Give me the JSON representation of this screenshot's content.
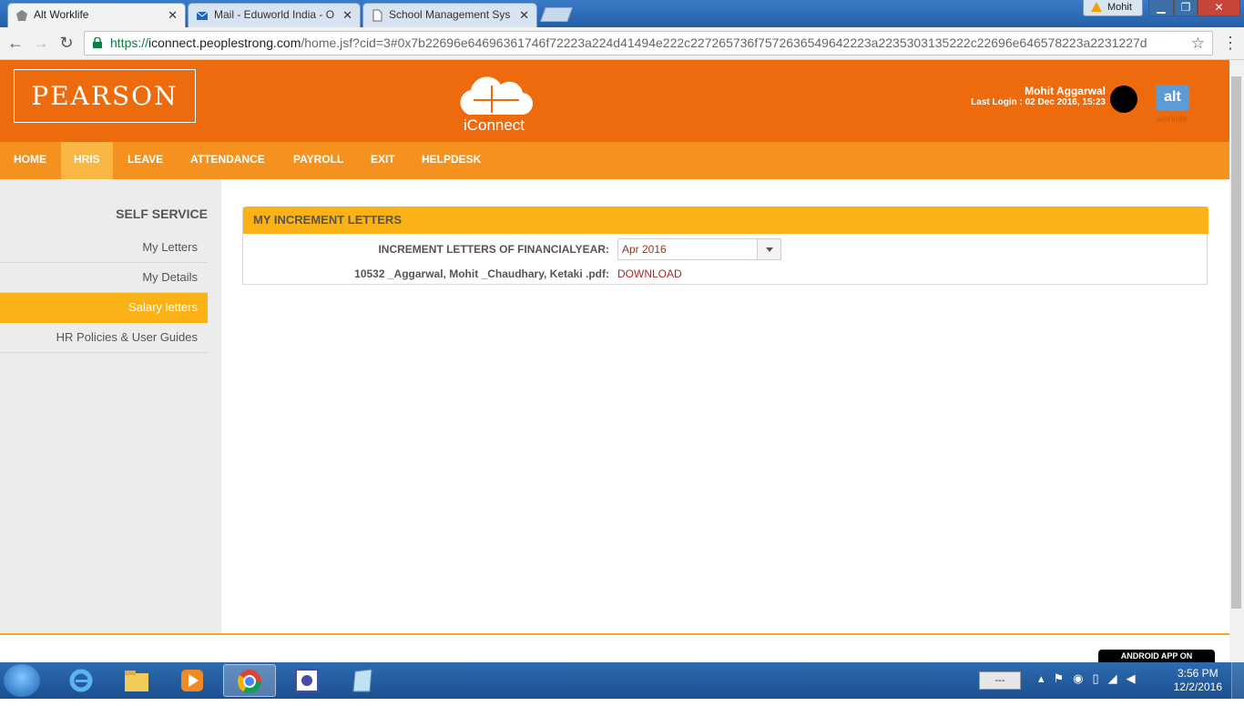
{
  "browser": {
    "tabs": [
      {
        "label": "Alt Worklife",
        "active": true
      },
      {
        "label": "Mail - Eduworld India - O",
        "active": false
      },
      {
        "label": "School Management Sys",
        "active": false
      }
    ],
    "profile": "Mohit",
    "window_controls": {
      "minimize": "▁",
      "maximize": "❐",
      "close": "✕"
    },
    "url_secure": "https://",
    "url_host": "iconnect.peoplestrong.com",
    "url_rest": "/home.jsf?cid=3#0x7b22696e64696361746f72223a224d41494e222c227265736f7572636549642223a2235303135222c22696e646578223a2231227d"
  },
  "header": {
    "brand": "PEARSON",
    "app_name": "iConnect",
    "user_name": "Mohit Aggarwal",
    "last_login": "Last Login : 02 Dec 2016, 15:23",
    "alt_logo": "alt",
    "alt_logo_sub": "worklife"
  },
  "nav": {
    "items": [
      "HOME",
      "HRIS",
      "LEAVE",
      "ATTENDANCE",
      "PAYROLL",
      "EXIT",
      "HELPDESK"
    ],
    "active": "HRIS"
  },
  "sidebar": {
    "title": "SELF SERVICE",
    "items": [
      "My Letters",
      "My Details",
      "Salary letters",
      "HR Policies & User Guides"
    ],
    "active": "Salary letters"
  },
  "panel": {
    "title": "MY INCREMENT LETTERS",
    "field_label": "INCREMENT LETTERS OF FINANCIALYEAR:",
    "selected_year": "Apr 2016",
    "file_name": "10532 _Aggarwal, Mohit _Chaudhary, Ketaki .pdf:",
    "download_label": "DOWNLOAD"
  },
  "footer": {
    "android_badge": "ANDROID APP ON"
  },
  "taskbar": {
    "tray_box": "---",
    "time": "3:56 PM",
    "date": "12/2/2016"
  },
  "colors": {
    "header": "#ee6b0d",
    "nav": "#f5921f",
    "accent": "#fbb216",
    "link": "#a52a2a"
  }
}
